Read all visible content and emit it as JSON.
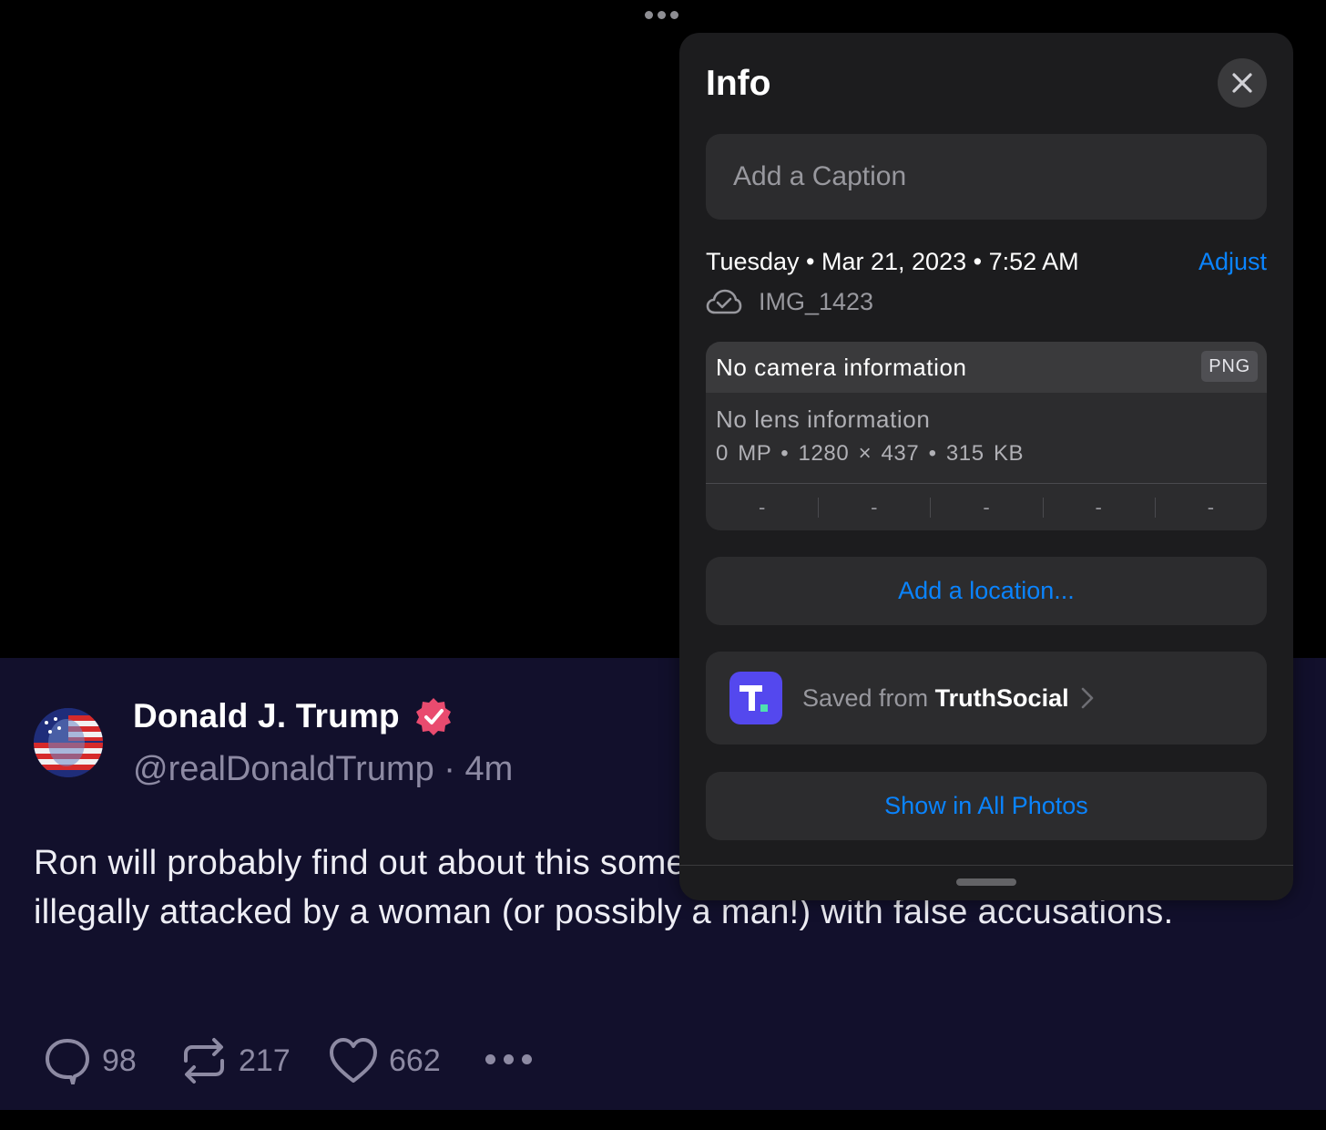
{
  "post": {
    "author_name": "Donald J. Trump",
    "handle": "@realDonaldTrump · 4m",
    "text": "Ron will probably find out about this someday, when he is unfairly and illegally attacked by a woman (or possibly a man!) with false accusations.",
    "replies": "98",
    "reposts": "217",
    "likes": "662",
    "icons": {
      "reply": "reply-icon",
      "repost": "repost-icon",
      "like": "heart-icon",
      "more": "more-icon",
      "verified": "verified-badge-icon"
    },
    "colors": {
      "background": "#12102c",
      "verified": "#e94b6f",
      "muted": "#8d8aa3"
    }
  },
  "info": {
    "title": "Info",
    "caption_placeholder": "Add a Caption",
    "date": "Tuesday • Mar 21, 2023 • 7:52 AM",
    "adjust_label": "Adjust",
    "file_name": "IMG_1423",
    "camera": "No camera information",
    "format": "PNG",
    "lens": "No lens information",
    "specs": "0 MP • 1280 × 437 • 315 KB",
    "exif_cells": [
      "-",
      "-",
      "-",
      "-",
      "-"
    ],
    "location_label": "Add a location...",
    "saved_prefix": "Saved from ",
    "saved_app": "TruthSocial",
    "show_all_label": "Show in All Photos",
    "colors": {
      "accent": "#0a84ff",
      "sheet": "#1c1c1e",
      "card": "#2c2c2e",
      "app_icon": "#5448ee"
    }
  }
}
